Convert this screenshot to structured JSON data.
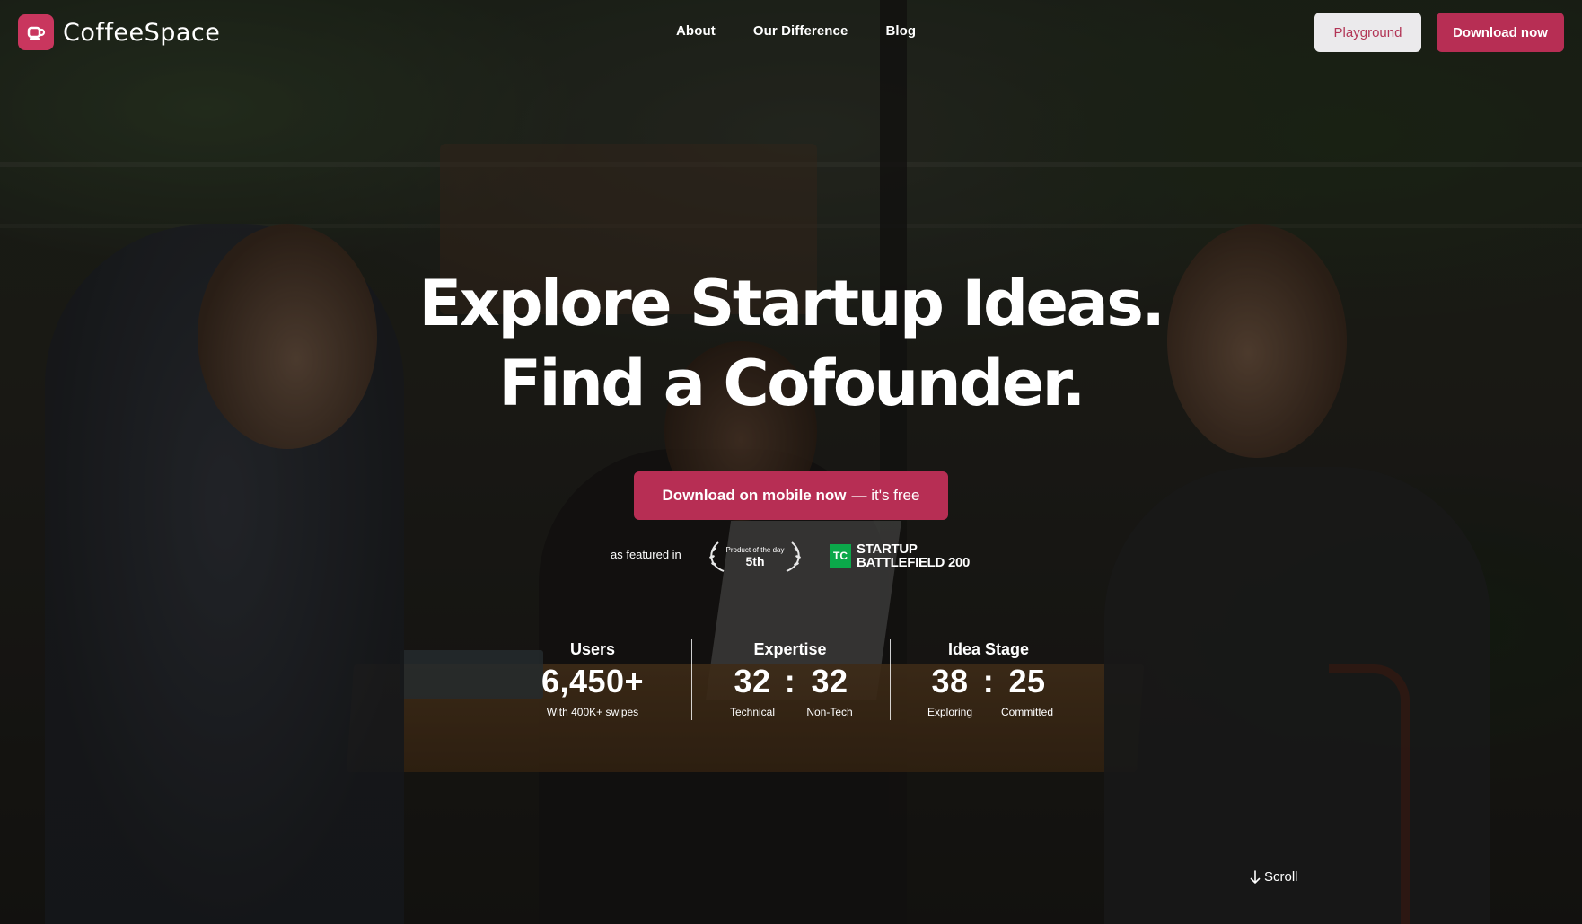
{
  "brand": {
    "name": "CoffeeSpace",
    "logo_icon": "coffee-cup-icon",
    "accent": "#b72e54"
  },
  "nav": {
    "items": [
      "About",
      "Our Difference",
      "Blog"
    ]
  },
  "header": {
    "playground_label": "Playground",
    "download_label": "Download now"
  },
  "hero": {
    "headline_line1": "Explore Startup Ideas.",
    "headline_line2": "Find a Cofounder.",
    "cta_strong": "Download on mobile now",
    "cta_light": "— it's free"
  },
  "featured": {
    "label": "as featured in",
    "award_caption": "Product of the day",
    "award_rank": "5th",
    "tc_badge": "TC",
    "tc_line1": "STARTUP",
    "tc_line2": "BATTLEFIELD 200"
  },
  "stats": {
    "users": {
      "title": "Users",
      "value": "6,450+",
      "sub": "With 400K+ swipes"
    },
    "expertise": {
      "title": "Expertise",
      "left_value": "32",
      "right_value": "32",
      "separator": ":",
      "left_label": "Technical",
      "right_label": "Non-Tech"
    },
    "idea_stage": {
      "title": "Idea Stage",
      "left_value": "38",
      "right_value": "25",
      "separator": ":",
      "left_label": "Exploring",
      "right_label": "Committed"
    }
  },
  "scroll": {
    "label": "Scroll",
    "icon": "arrow-down-icon"
  }
}
